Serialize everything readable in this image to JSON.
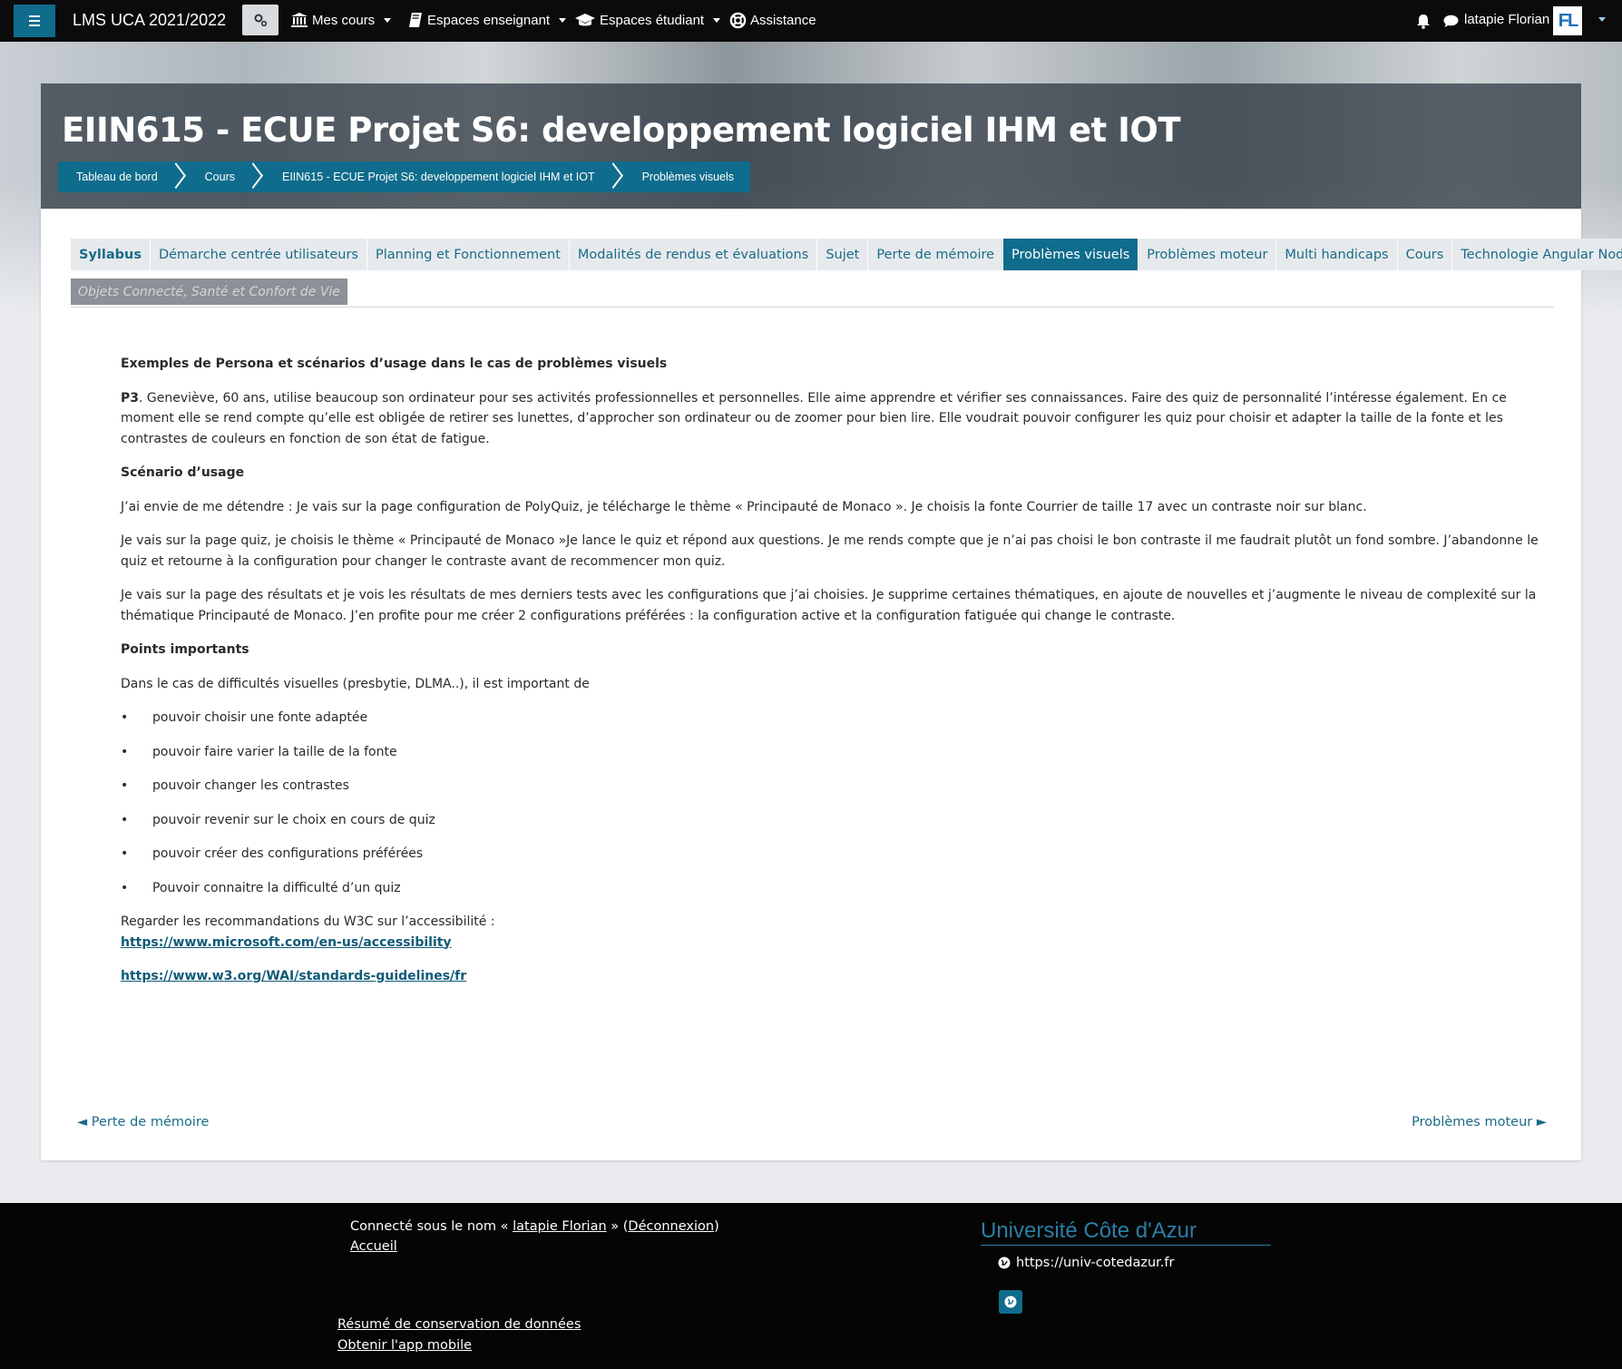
{
  "navbar": {
    "site_name": "LMS UCA 2021/2022",
    "items": [
      {
        "label": "Mes cours",
        "icon": "institution-icon"
      },
      {
        "label": "Espaces enseignant",
        "icon": "book-icon"
      },
      {
        "label": "Espaces étudiant",
        "icon": "graduation-cap-icon"
      },
      {
        "label": "Assistance",
        "icon": "life-ring-icon"
      }
    ],
    "user_name": "latapie Florian",
    "avatar_initials": "FL"
  },
  "header": {
    "title": "EIIN615 - ECUE Projet S6: developpement logiciel IHM et IOT",
    "breadcrumb": [
      "Tableau de bord",
      "Cours",
      "EIIN615 - ECUE Projet S6: developpement logiciel IHM et IOT",
      "Problèmes visuels"
    ]
  },
  "tabs": [
    {
      "label": "Syllabus",
      "state": "bold"
    },
    {
      "label": "Démarche centrée utilisateurs",
      "state": "normal"
    },
    {
      "label": "Planning et Fonctionnement",
      "state": "normal"
    },
    {
      "label": "Modalités de rendus et évaluations",
      "state": "normal"
    },
    {
      "label": "Sujet",
      "state": "normal"
    },
    {
      "label": "Perte de mémoire",
      "state": "normal"
    },
    {
      "label": "Problèmes visuels",
      "state": "active"
    },
    {
      "label": "Problèmes moteur",
      "state": "normal"
    },
    {
      "label": "Multi handicaps",
      "state": "normal"
    },
    {
      "label": "Cours",
      "state": "normal"
    },
    {
      "label": "Technologie Angular NodeJs",
      "state": "normal"
    }
  ],
  "tab_disabled": "Objets Connecté, Santé et Confort de Vie",
  "content": {
    "heading": "Exemples de Persona et scénarios d’usage dans le cas de problèmes visuels",
    "persona_label": "P3",
    "persona_text": ". Geneviève, 60 ans, utilise beaucoup son ordinateur pour ses activités professionnelles et personnelles. Elle aime apprendre et vérifier ses connaissances. Faire des quiz de personnalité l’intéresse également. En ce moment elle se rend compte qu’elle est obligée de retirer ses lunettes, d’approcher son ordinateur ou de zoomer pour bien lire. Elle voudrait pouvoir configurer les quiz pour choisir et adapter la taille de la fonte et les contrastes de couleurs en fonction de son état de fatigue.",
    "scenario_heading": "Scénario d’usage",
    "scenario_p1": "J’ai envie de me détendre : Je vais sur la page configuration de PolyQuiz, je télécharge le thème « Principauté de Monaco ». Je choisis la fonte Courrier de taille 17 avec un contraste noir sur blanc.",
    "scenario_p2": "Je vais sur la page quiz, je choisis le thème « Principauté de Monaco »Je lance le quiz et répond aux questions. Je me rends compte que je n’ai pas choisi le bon contraste il me faudrait plutôt un fond sombre. J’abandonne le quiz et retourne à la configuration pour changer le contraste avant de recommencer mon quiz.",
    "scenario_p3": "Je vais sur la page des résultats et je vois les résultats de mes derniers tests avec les configurations que j’ai choisies. Je supprime certaines thématiques, en ajoute de nouvelles et j’augmente le niveau de complexité sur la thématique Principauté de Monaco. J’en profite pour me créer 2 configurations préférées : la configuration active et la configuration fatiguée qui change le contraste.",
    "points_heading": "Points importants",
    "points_intro": "Dans le cas de difficultés visuelles (presbytie, DLMA..), il est important de",
    "bullet_char": "•",
    "bullets": [
      "pouvoir choisir une fonte adaptée",
      "pouvoir faire varier la taille de la fonte",
      "pouvoir changer les contrastes",
      "pouvoir revenir sur le choix en cours de quiz",
      "pouvoir créer des configurations préférées",
      "Pouvoir connaitre la difficulté d’un quiz"
    ],
    "w3c_text": "Regarder les recommandations du W3C sur l’accessibilité :",
    "link1": "https://www.microsoft.com/en-us/accessibility",
    "link2": "https://www.w3.org/WAI/standards-guidelines/fr"
  },
  "pager": {
    "prev": "◄ Perte de mémoire",
    "next": "Problèmes moteur ►"
  },
  "footer": {
    "login_prefix": "Connecté sous le nom « ",
    "login_user": "latapie Florian",
    "login_mid": " » (",
    "logout": "Déconnexion",
    "login_suffix": ")",
    "home": "Accueil",
    "policy": "Résumé de conservation de données",
    "app": "Obtenir l'app mobile",
    "university": "Université Côte d'Azur",
    "url": "https://univ-cotedazur.fr"
  },
  "colors": {
    "navbar_bg": "#0b0b0b",
    "brand_primary": "#0f6c8c",
    "link": "#1a6b8a",
    "footer_bg": "#050505"
  }
}
